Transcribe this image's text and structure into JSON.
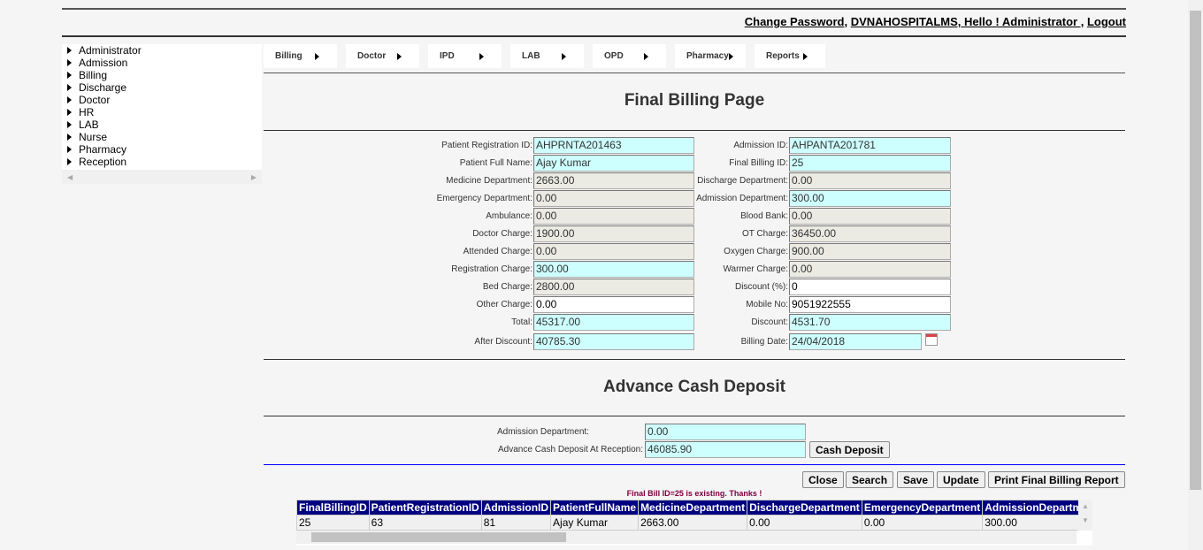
{
  "header": {
    "change_password": "Change Password",
    "sep1": ", ",
    "app_name": "DVNAHOSPITALMS,",
    "greeting": " Hello ! Administrator ,",
    "logout": "Logout"
  },
  "sidebar": {
    "items": [
      "Administrator",
      "Admission",
      "Billing",
      "Discharge",
      "Doctor",
      "HR",
      "LAB",
      "Nurse",
      "Pharmacy",
      "Reception"
    ]
  },
  "menu": {
    "items": [
      "Billing",
      "Doctor",
      "IPD",
      "LAB",
      "OPD",
      "Pharmacy",
      "Reports"
    ]
  },
  "page_title": "Final Billing Page",
  "form": {
    "left": [
      {
        "label": "Patient Registration ID:",
        "value": "AHPRNTA201463",
        "style": "cyan"
      },
      {
        "label": "Patient Full Name:",
        "value": "Ajay Kumar",
        "style": "cyan"
      },
      {
        "label": "Medicine Department:",
        "value": "2663.00",
        "style": "ro"
      },
      {
        "label": "Emergency Department:",
        "value": "0.00",
        "style": "ro"
      },
      {
        "label": "Ambulance:",
        "value": "0.00",
        "style": "ro"
      },
      {
        "label": "Doctor Charge:",
        "value": "1900.00",
        "style": "ro"
      },
      {
        "label": "Attended Charge:",
        "value": "0.00",
        "style": "ro"
      },
      {
        "label": "Registration Charge:",
        "value": "300.00",
        "style": "cyan"
      },
      {
        "label": "Bed Charge:",
        "value": "2800.00",
        "style": "ro"
      },
      {
        "label": "Other Charge:",
        "value": "0.00",
        "style": "wh"
      },
      {
        "label": "Total:",
        "value": "45317.00",
        "style": "cyan"
      },
      {
        "label": "After Discount:",
        "value": "40785.30",
        "style": "cyan"
      }
    ],
    "right": [
      {
        "label": "Admission ID:",
        "value": "AHPANTA201781",
        "style": "cyan"
      },
      {
        "label": "Final Billing ID:",
        "value": "25",
        "style": "cyan"
      },
      {
        "label": "Discharge Department:",
        "value": "0.00",
        "style": "ro"
      },
      {
        "label": "Admission Department:",
        "value": "300.00",
        "style": "cyan"
      },
      {
        "label": "Blood Bank:",
        "value": "0.00",
        "style": "ro"
      },
      {
        "label": "OT Charge:",
        "value": "36450.00",
        "style": "ro"
      },
      {
        "label": "Oxygen Charge:",
        "value": "900.00",
        "style": "ro"
      },
      {
        "label": "Warmer Charge:",
        "value": "0.00",
        "style": "ro"
      },
      {
        "label": "Discount (%):",
        "value": "0",
        "style": "wh"
      },
      {
        "label": "Mobile No:",
        "value": "9051922555",
        "style": "wh"
      },
      {
        "label": "Discount:",
        "value": "4531.70",
        "style": "cyan"
      },
      {
        "label": "Billing Date:",
        "value": "24/04/2018",
        "style": "cyan"
      }
    ]
  },
  "advance": {
    "title": "Advance Cash Deposit",
    "adm_label": "Admission Department:",
    "adm_value": "0.00",
    "cash_label": "Advance Cash Deposit At Reception:",
    "cash_value": "46085.90",
    "cash_button": "Cash Deposit"
  },
  "actions": [
    "Close",
    "Search",
    "Save",
    "Update",
    "Print Final Billing Report"
  ],
  "message": "Final Bill ID=25 is existing. Thanks !",
  "table": {
    "columns": [
      "FinalBillingID",
      "PatientRegistrationID",
      "AdmissionID",
      "PatientFullName",
      "MedicineDepartment",
      "DischargeDepartment",
      "EmergencyDepartment",
      "AdmissionDepartment"
    ],
    "rows": [
      [
        "25",
        "63",
        "81",
        "Ajay Kumar",
        "2663.00",
        "0.00",
        "0.00",
        "300.00"
      ]
    ]
  },
  "colors": {
    "header_bg": "#000080",
    "input_cyan": "#ceffff",
    "input_readonly": "#ebebe4",
    "divider_blue": "#0000ff"
  }
}
